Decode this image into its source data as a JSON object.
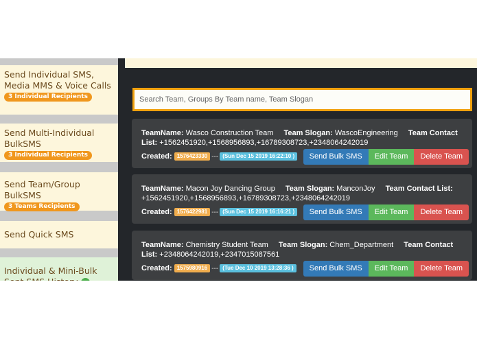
{
  "sidebar": {
    "items": [
      {
        "label": "Send Individual SMS, Media MMS & Voice Calls",
        "badge": "3 Individual Recipients"
      },
      {
        "label": "Send Multi-Individual BulkSMS",
        "badge": "3 Individual Recipients"
      },
      {
        "label": "Send Team/Group BulkSMS",
        "badge": "3 Teams Recipients"
      },
      {
        "label": "Send Quick SMS"
      },
      {
        "label": "Individual & Mini-Bulk Sent SMS History"
      }
    ]
  },
  "search": {
    "placeholder": "Search Team, Groups By Team name, Team Slogan"
  },
  "labels": {
    "team_name": "TeamName:",
    "team_slogan": "Team Slogan:",
    "team_contacts": "Team Contact List:",
    "created": "Created:",
    "separator": "---"
  },
  "buttons": {
    "send_bulk": "Send Bulk SMS",
    "edit": "Edit Team",
    "delete": "Delete Team"
  },
  "teams": [
    {
      "name": "Wasco Construction Team",
      "slogan": "WascoEngineering",
      "contacts": "+1562451920,+1568956893,+16789308723,+2348064242019",
      "created_stamp": "1576423330",
      "created_date": "(Sun Dec 15 2019 16:22:10 )"
    },
    {
      "name": "Macon Joy Dancing Group",
      "slogan": "ManconJoy",
      "contacts": "+1562451920,+1568956893,+16789308723,+2348064242019",
      "created_stamp": "1576422981",
      "created_date": "(Sun Dec 15 2019 16:16:21 )"
    },
    {
      "name": "Chemistry Student Team",
      "slogan": "Chem_Department",
      "contacts": "+2348064242019,+2347015087561",
      "created_stamp": "1575980916",
      "created_date": "(Tue Dec 10 2019 13:28:36 )"
    }
  ],
  "colors": {
    "accent_orange": "#f0a10e",
    "panel_dark": "#23262a",
    "card": "#3d3f41",
    "btn_primary": "#337ab7",
    "btn_success": "#5cb85c",
    "btn_danger": "#d9534f"
  }
}
